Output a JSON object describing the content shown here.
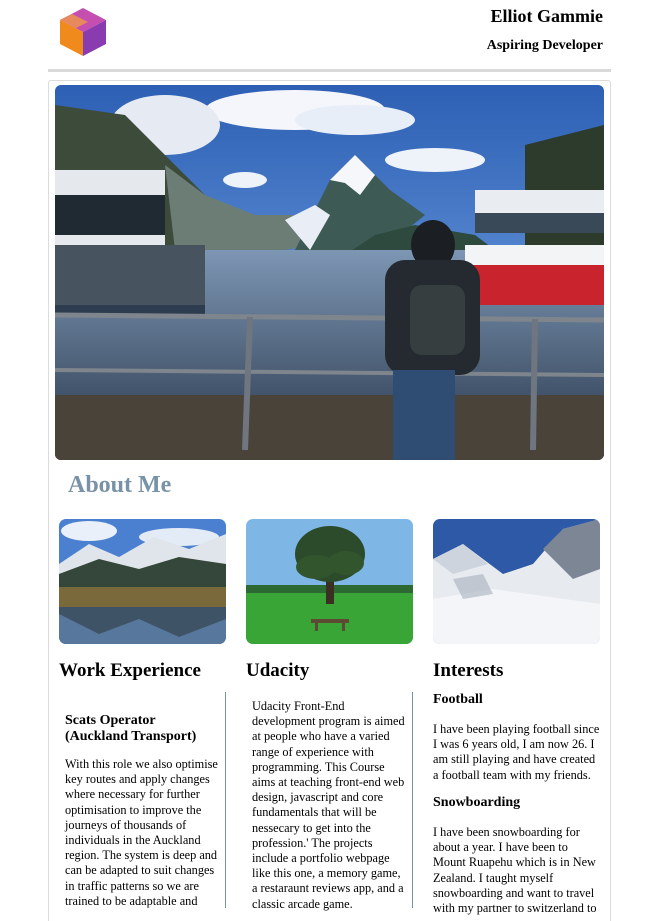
{
  "header": {
    "name": "Elliot Gammie",
    "subtitle": "Aspiring Developer"
  },
  "about": {
    "heading": "About Me"
  },
  "columns": {
    "work": {
      "heading": "Work Experience",
      "job_title": "Scats Operator (Auckland Transport)",
      "description": "With this role we also optimise key routes and apply changes where necessary for further optimisation to improve the journeys of thousands of individuals in the Auckland region. The system is deep and can be adapted to suit changes in traffic patterns so we are trained to be adaptable and"
    },
    "udacity": {
      "heading": "Udacity",
      "description": "Udacity Front-End development program is aimed at people who have a varied range of experience with programming. This Course aims at teaching front-end web design, javascript and core fundamentals that will be nessecary to get into the profession.' The projects include a portfolio webpage like this one, a memory game, a restaraunt reviews app, and a classic arcade game."
    },
    "interests": {
      "heading": "Interests",
      "football_heading": "Football",
      "football_text": "I have been playing football since I was 6 years old, I am now 26. I am still playing and have created a football team with my friends.",
      "snowboarding_heading": "Snowboarding",
      "snowboarding_text": "I have been snowboarding for about a year. I have been to Mount Ruapehu which is in New Zealand. I taught myself snowboarding and want to travel with my partner to switzerland to"
    }
  },
  "colors": {
    "about_heading": "#7893a8",
    "divider": "#d9d9d9",
    "column_rule": "#7c8fa8"
  }
}
